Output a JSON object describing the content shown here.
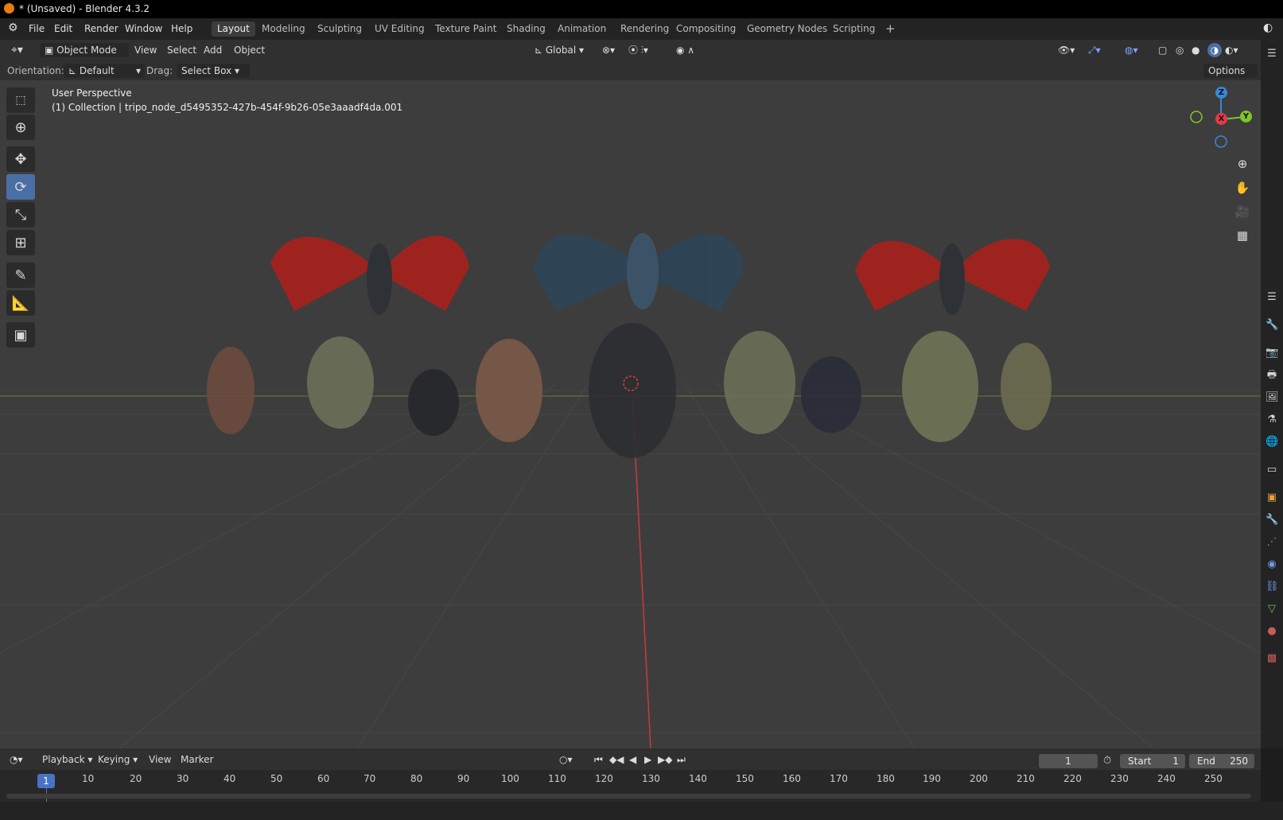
{
  "title": "* (Unsaved) - Blender 4.3.2",
  "menu": [
    "File",
    "Edit",
    "Render",
    "Window",
    "Help"
  ],
  "workspaces": [
    "Layout",
    "Modeling",
    "Sculpting",
    "UV Editing",
    "Texture Paint",
    "Shading",
    "Animation",
    "Rendering",
    "Compositing",
    "Geometry Nodes",
    "Scripting"
  ],
  "active_workspace": "Layout",
  "header": {
    "mode": "Object Mode",
    "view": "View",
    "select": "Select",
    "add": "Add",
    "object": "Object",
    "transform_orientation": "Global"
  },
  "toolsettings": {
    "orientation_label": "Orientation:",
    "orientation_value": "Default",
    "drag_label": "Drag:",
    "drag_value": "Select Box",
    "options": "Options"
  },
  "viewport": {
    "view_name": "User Perspective",
    "collection_info": "(1) Collection | tripo_node_d5495352-427b-454f-9b26-05e3aaadf4da.001"
  },
  "gizmo": {
    "x": "X",
    "y": "Y",
    "z": "Z"
  },
  "timeline": {
    "playback": "Playback",
    "keying": "Keying",
    "view": "View",
    "marker": "Marker",
    "current_frame": "1",
    "start_label": "Start",
    "start_value": "1",
    "end_label": "End",
    "end_value": "250",
    "ticks": [
      "10",
      "20",
      "30",
      "40",
      "50",
      "60",
      "70",
      "80",
      "90",
      "100",
      "110",
      "120",
      "130",
      "140",
      "150",
      "160",
      "170",
      "180",
      "190",
      "200",
      "210",
      "220",
      "230",
      "240",
      "250"
    ]
  },
  "colors": {
    "accent": "#4a6fa5",
    "x_axis": "#e8374b",
    "y_axis": "#7ec62b",
    "z_axis": "#3a86d6"
  }
}
